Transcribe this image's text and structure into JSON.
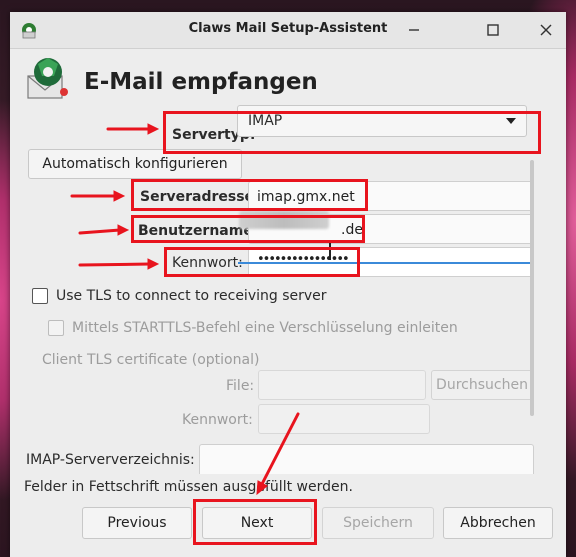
{
  "window": {
    "title": "Claws Mail Setup-Assistent",
    "controls": [
      "minimize-icon",
      "maximize-icon",
      "close-icon"
    ]
  },
  "page": {
    "heading": "E-Mail empfangen",
    "header_icon": "claws-mail-icon"
  },
  "form": {
    "servertyp_label": "Servertyp:",
    "servertyp_value": "IMAP",
    "autoconfig_label": "Automatisch konfigurieren",
    "serveradresse_label": "Serveradresse:",
    "serveradresse_value": "imap.gmx.net",
    "benutzername_label": "Benutzername:",
    "benutzername_value_suffix": ".de",
    "kennwort_label": "Kennwort:",
    "kennwort_value": "••••••••••••••••",
    "use_tls_label": "Use TLS to connect to receiving server",
    "use_tls_checked": false,
    "starttls_label": "Mittels STARTTLS-Befehl eine Verschlüsselung einleiten",
    "starttls_checked": false,
    "client_cert_label": "Client TLS certificate (optional)",
    "file_label": "File:",
    "file_value": "",
    "browse_label": "Durchsuchen",
    "cert_password_label": "Kennwort:",
    "cert_password_value": "",
    "imap_dir_label": "IMAP-Serververzeichnis:",
    "imap_dir_value": ""
  },
  "footer": {
    "note": "Felder in Fettschrift müssen ausgefüllt werden.",
    "previous_label": "Previous",
    "next_label": "Next",
    "save_label": "Speichern",
    "cancel_label": "Abbrechen"
  },
  "annotation_color": "#e8141e"
}
